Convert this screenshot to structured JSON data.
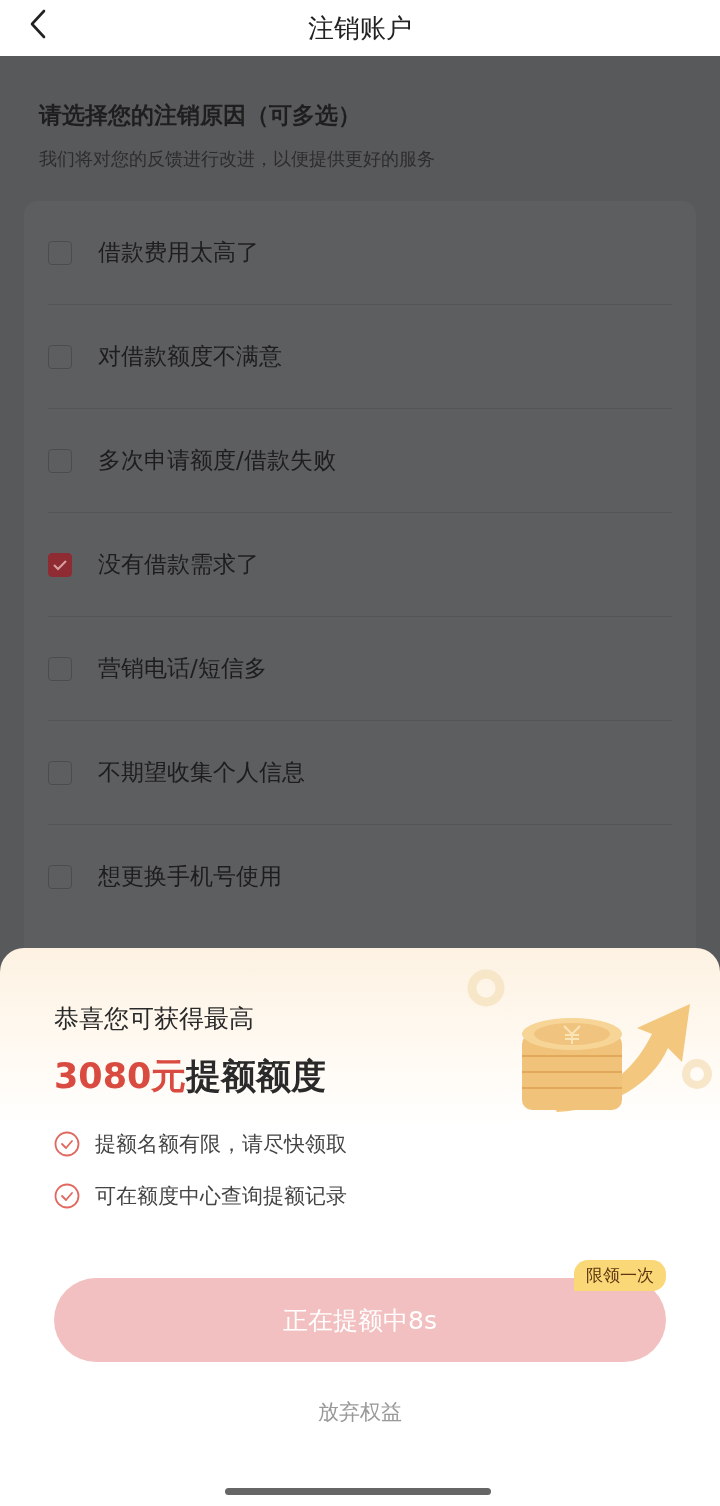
{
  "header": {
    "title": "注销账户"
  },
  "page": {
    "heading": "请选择您的注销原因（可多选）",
    "subheading": "我们将对您的反馈进行改进，以便提供更好的服务",
    "reasons": [
      {
        "label": "借款费用太高了",
        "checked": false
      },
      {
        "label": "对借款额度不满意",
        "checked": false
      },
      {
        "label": "多次申请额度/借款失败",
        "checked": false
      },
      {
        "label": "没有借款需求了",
        "checked": true
      },
      {
        "label": "营销电话/短信多",
        "checked": false
      },
      {
        "label": "不期望收集个人信息",
        "checked": false
      },
      {
        "label": "想更换手机号使用",
        "checked": false
      }
    ]
  },
  "sheet": {
    "title": "恭喜您可获得最高",
    "amount": "3080元",
    "amount_suffix": "提额额度",
    "benefits": [
      "提额名额有限，请尽快领取",
      "可在额度中心查询提额记录"
    ],
    "button": {
      "label": "正在提额中8s",
      "disabled": true
    },
    "badge": "限领一次",
    "decline": "放弃权益"
  }
}
